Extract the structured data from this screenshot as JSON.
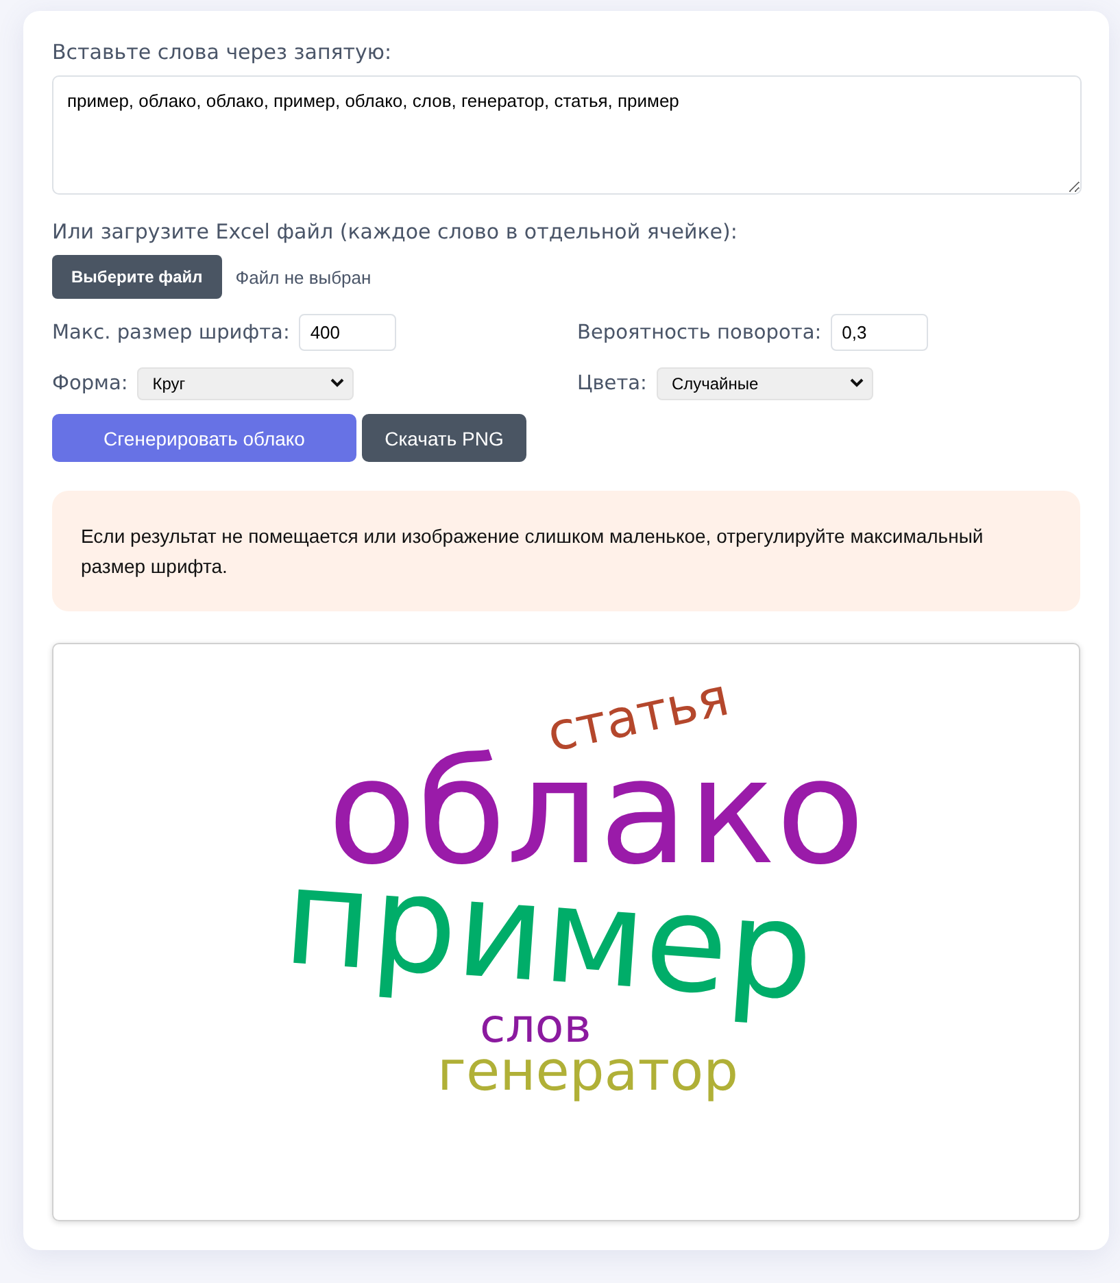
{
  "words_label": "Вставьте слова через запятую:",
  "words_value": "пример, облако, облако, пример, облако, слов, генератор, статья, пример",
  "excel_label": "Или загрузите Excel файл (каждое слово в отдельной ячейке):",
  "file_button": "Выберите файл",
  "file_status": "Файл не выбран",
  "settings": [
    {
      "kind": "input",
      "label": "Макс. размер шрифта:",
      "value": "400"
    },
    {
      "kind": "input",
      "label": "Вероятность поворота:",
      "value": "0,3"
    },
    {
      "kind": "select",
      "label": "Форма:",
      "value": "Круг"
    },
    {
      "kind": "select",
      "label": "Цвета:",
      "value": "Случайные"
    }
  ],
  "buttons": [
    {
      "label": "Сгенерировать облако",
      "kind": "primary"
    },
    {
      "label": "Скачать PNG",
      "kind": "secondary"
    }
  ],
  "notice": "Если результат не помещается или изображение слишком маленькое, отрегулируйте максимальный размер шрифта.",
  "cloud_words": [
    {
      "text": "статья",
      "color": "#b4472c"
    },
    {
      "text": "облако",
      "color": "#9a1ba9"
    },
    {
      "text": "пример",
      "color": "#00ad69"
    },
    {
      "text": "слов",
      "color": "#8b1a9f"
    },
    {
      "text": "генератор",
      "color": "#b0b037"
    }
  ]
}
